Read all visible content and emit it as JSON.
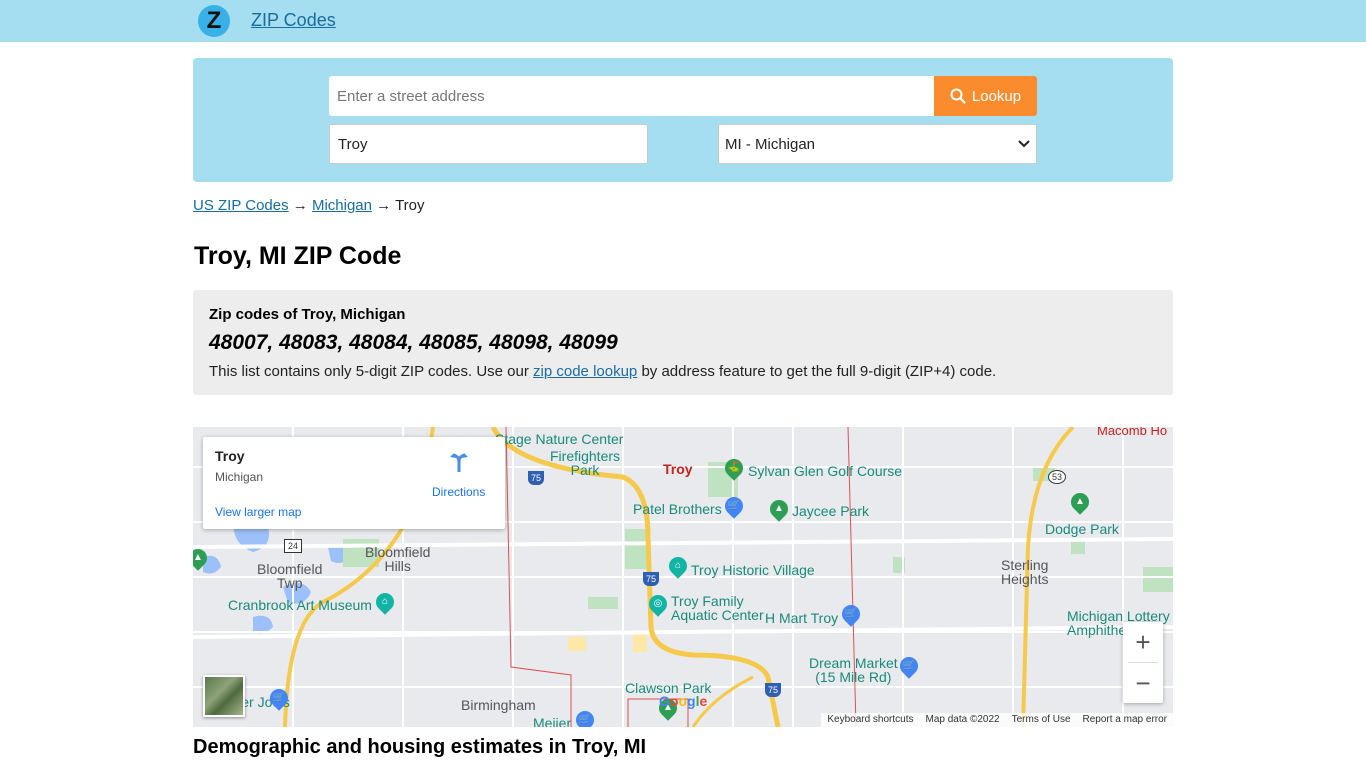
{
  "header": {
    "brand": "ZIP Codes",
    "logo_letter": "Z"
  },
  "search": {
    "address_placeholder": "Enter a street address",
    "lookup_label": "Lookup",
    "city_value": "Troy",
    "state_selected": "MI - Michigan"
  },
  "breadcrumb": {
    "root": "US ZIP Codes",
    "sep1": "→",
    "state": "Michigan",
    "sep2": "→",
    "city": "Troy"
  },
  "page_title": "Troy, MI ZIP Code",
  "zip_box": {
    "label": "Zip codes of Troy, Michigan",
    "codes": "48007, 48083, 48084, 48085, 48098, 48099",
    "note_before": "This list contains only 5-digit ZIP codes. Use our ",
    "note_link": "zip code lookup",
    "note_after": " by address feature to get the full 9-digit (ZIP+4) code."
  },
  "map": {
    "card_title": "Troy",
    "card_subtitle": "Michigan",
    "card_link": "View larger map",
    "directions": "Directions",
    "places": {
      "troy": "Troy",
      "bloomfield_hills": "Bloomfield\nHills",
      "bloomfield_twp": "Bloomfield\nTwp",
      "birmingham": "Birmingham",
      "sterling_heights": "Sterling\nHeights",
      "macomb": "Macomb Ho"
    },
    "pois": {
      "nature": "Stage Nature Center",
      "firefighters": "Firefighters\nPark",
      "golf": "Sylvan Glen Golf Course",
      "patel": "Patel Brothers",
      "jaycee": "Jaycee Park",
      "dodge": "Dodge Park",
      "historic": "Troy Historic Village",
      "aquatic": "Troy Family\nAquatic Center",
      "hmart": "H Mart Troy",
      "cranbrook": "Cranbrook Art Museum",
      "lottery": "Michigan Lottery\nAmphithe",
      "dream": "Dream Market\n(15 Mile Rd)",
      "clawson": "Clawson Park",
      "meijer": "Meijer",
      "joes": "Trader Joe's"
    },
    "shields": {
      "i75a": "75",
      "i75b": "75",
      "i75c": "75",
      "us24": "24",
      "m53": "53"
    },
    "zoom_in": "+",
    "zoom_out": "−",
    "google": "Google",
    "attrib": [
      "Keyboard shortcuts",
      "Map data ©2022",
      "Terms of Use",
      "Report a map error"
    ]
  },
  "section_title": "Demographic and housing estimates in Troy, MI",
  "colors": {
    "header_bg": "#a5ddf1",
    "accent": "#fb8c2d",
    "link": "#1a6c9c"
  }
}
